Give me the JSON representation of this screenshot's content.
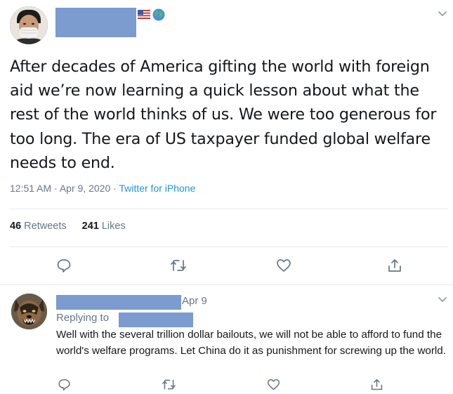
{
  "main_tweet": {
    "text": "After decades of America gifting the world with foreign aid we’re now learning a quick lesson about what the rest of the world thinks of us.  We were too generous for too long.  The era of US taxpayer funded global welfare needs to end.",
    "time": "12:51 AM",
    "date": "Apr 9, 2020",
    "separator": "·",
    "source": "Twitter for iPhone",
    "retweets_count": "46",
    "retweets_label": "Retweets",
    "likes_count": "241",
    "likes_label": "Likes"
  },
  "reply_tweet": {
    "date": "Apr 9",
    "replying_label": "Replying to",
    "text": "Well with the several trillion dollar bailouts, we will not be able to afford to fund the world's welfare programs.  Let China do it as punishment for screwing up the world."
  },
  "colors": {
    "redaction": "#7c9bcf",
    "link": "#1b95e0",
    "muted": "#657786",
    "icon": "#657786"
  },
  "icons": {
    "reply": "speech-bubble-icon",
    "retweet": "retweet-icon",
    "like": "heart-icon",
    "share": "share-icon",
    "menu": "chevron-down-icon",
    "flag": "us-flag-icon",
    "globe": "globe-icon"
  }
}
